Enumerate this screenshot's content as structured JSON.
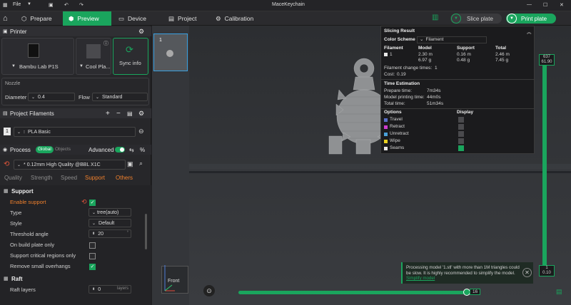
{
  "titlebar": {
    "file_menu": "File",
    "title": "MaceKeychain"
  },
  "nav": {
    "tabs": [
      {
        "label": "Prepare"
      },
      {
        "label": "Preview"
      },
      {
        "label": "Device"
      },
      {
        "label": "Project"
      },
      {
        "label": "Calibration"
      }
    ],
    "slice_label": "Slice plate",
    "print_label": "Print plate"
  },
  "printer": {
    "section_title": "Printer",
    "printer_name": "Bambu Lab P1S",
    "plate_name": "Cool Pla...",
    "sync_label": "Sync info",
    "nozzle_title": "Nozzle",
    "diameter_label": "Diameter",
    "diameter_value": "0.4",
    "flow_label": "Flow",
    "flow_value": "Standard"
  },
  "filaments": {
    "section_title": "Project Filaments",
    "items": [
      {
        "index": "1",
        "name": "PLA Basic",
        "color": "#e8e8e8"
      }
    ]
  },
  "process": {
    "section_title": "Process",
    "toggle_global": "Global",
    "toggle_objects": "Objects",
    "advanced_label": "Advanced",
    "preset": "* 0.12mm High Quality @BBL X1C",
    "tabs": [
      "Quality",
      "Strength",
      "Speed",
      "Support",
      "Others"
    ],
    "active_tab": "Support"
  },
  "support": {
    "title": "Support",
    "settings": [
      {
        "label": "Enable support",
        "type": "checkbox",
        "checked": true,
        "highlight": true
      },
      {
        "label": "Type",
        "type": "select",
        "value": "tree(auto)"
      },
      {
        "label": "Style",
        "type": "select",
        "value": "Default"
      },
      {
        "label": "Threshold angle",
        "type": "spin",
        "value": "20",
        "unit": "°"
      },
      {
        "label": "On build plate only",
        "type": "checkbox",
        "checked": false
      },
      {
        "label": "Support critical regions only",
        "type": "checkbox",
        "checked": false
      },
      {
        "label": "Remove small overhangs",
        "type": "checkbox",
        "checked": true
      }
    ],
    "raft_title": "Raft",
    "raft_layers_label": "Raft layers",
    "raft_layers_value": "0",
    "raft_layers_unit": "layers"
  },
  "viewport": {
    "thumb_index": "1",
    "front_label": "Front",
    "layer_top": "637",
    "layer_top_height": "61.90",
    "layer_bottom": "1",
    "layer_bottom_height": "0.10",
    "move_bar_value": "16"
  },
  "slicing_result": {
    "title": "Slicing Result",
    "color_scheme_label": "Color Scheme",
    "color_scheme_value": "Filament",
    "headers": [
      "Filament",
      "Model",
      "Support",
      "Total"
    ],
    "rows": [
      {
        "filament": "1",
        "model_len": "2.30 m",
        "model_wt": "6.97 g",
        "support_len": "0.16 m",
        "support_wt": "0.48 g",
        "total_len": "2.46 m",
        "total_wt": "7.45 g"
      }
    ],
    "change_times_label": "Filament change times:",
    "change_times_value": "1",
    "cost_label": "Cost:",
    "cost_value": "0.19",
    "time_title": "Time Estimation",
    "time_rows": [
      {
        "label": "Prepare time:",
        "value": "7m34s"
      },
      {
        "label": "Model printing time:",
        "value": "44m0s"
      },
      {
        "label": "Total time:",
        "value": "51m34s"
      }
    ],
    "options_label": "Options",
    "display_label": "Display",
    "options": [
      {
        "label": "Travel",
        "color": "#5a6fc8",
        "shown": false
      },
      {
        "label": "Retract",
        "color": "#d03cd0",
        "shown": false
      },
      {
        "label": "Unretract",
        "color": "#4aa0d8",
        "shown": false
      },
      {
        "label": "Wipe",
        "color": "#e8d020",
        "shown": false
      },
      {
        "label": "Seams",
        "color": "#e8e8e8",
        "shown": true
      }
    ]
  },
  "notification": {
    "text": "Processing model '1.stl' with more than 1M triangles could be slow. It is highly recommended to simplify the model.",
    "link": "Simplify model"
  }
}
